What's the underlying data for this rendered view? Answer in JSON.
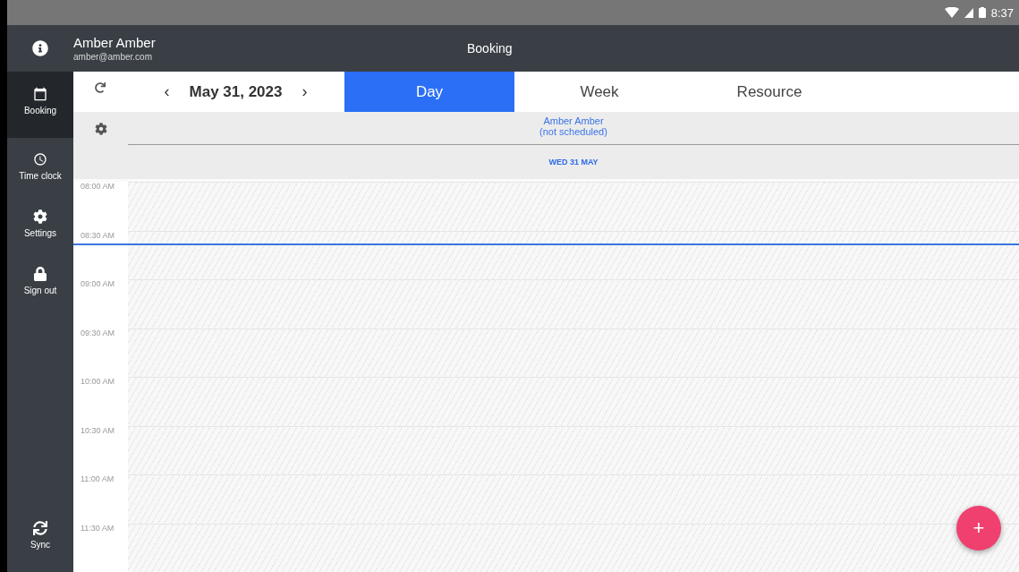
{
  "status_bar": {
    "time": "8:37"
  },
  "header": {
    "user_name": "Amber Amber",
    "user_email": "amber@amber.com",
    "title": "Booking"
  },
  "sidebar": {
    "items": [
      {
        "label": "Booking",
        "selected": true
      },
      {
        "label": "Time clock",
        "selected": false
      },
      {
        "label": "Settings",
        "selected": false
      },
      {
        "label": "Sign out",
        "selected": false
      }
    ],
    "bottom_item": {
      "label": "Sync"
    }
  },
  "toolbar": {
    "prev": "‹",
    "date": "May 31, 2023",
    "next": "›"
  },
  "tabs": [
    {
      "label": "Day",
      "selected": true
    },
    {
      "label": "Week",
      "selected": false
    },
    {
      "label": "Resource",
      "selected": false
    }
  ],
  "resource": {
    "name": "Amber Amber",
    "note": "(not scheduled)"
  },
  "day_label": "WED 31 MAY",
  "time_slots": [
    "08:00 AM",
    "08:30 AM",
    "09:00 AM",
    "09:30 AM",
    "10:00 AM",
    "10:30 AM",
    "11:00 AM",
    "11:30 AM"
  ],
  "fab": {
    "label": "+"
  }
}
